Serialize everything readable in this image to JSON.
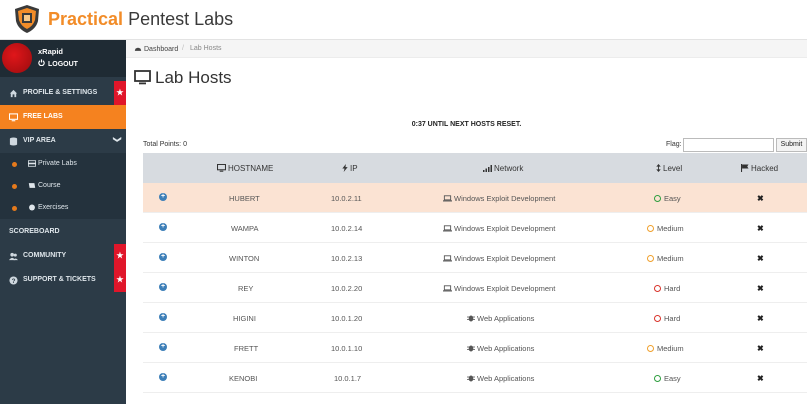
{
  "brand": {
    "part1": "Practical",
    "part2": " Pentest Labs"
  },
  "user": {
    "name": "xRapid",
    "logout_label": "LOGOUT"
  },
  "sidebar": {
    "items": [
      {
        "label": "PROFILE & SETTINGS",
        "icon": "home-icon",
        "star": "★"
      },
      {
        "label": "FREE LABS",
        "icon": "monitor-icon"
      },
      {
        "label": "VIP AREA",
        "icon": "database-icon",
        "chevron": "❯"
      },
      {
        "label": "SCOREBOARD",
        "icon": "none"
      },
      {
        "label": "COMMUNITY",
        "icon": "users-icon",
        "star": "★"
      },
      {
        "label": "SUPPORT & TICKETS",
        "icon": "question-icon",
        "star": "★"
      }
    ],
    "vip_sub": [
      {
        "label": "Private Labs",
        "icon": "server-icon"
      },
      {
        "label": "Course",
        "icon": "book-icon"
      },
      {
        "label": "Exercises",
        "icon": "globe-icon"
      }
    ]
  },
  "breadcrumb": {
    "home": "Dashboard",
    "separator": "/",
    "current": "Lab Hosts"
  },
  "page": {
    "title": "Lab Hosts",
    "timer": "0:37 UNTIL NEXT HOSTS RESET.",
    "total_points": "Total Points: 0",
    "flag_label": "Flag:",
    "flag_value": "",
    "submit_label": "Submit"
  },
  "table": {
    "headers": {
      "hostname": "HOSTNAME",
      "ip": "IP",
      "network": "Network",
      "level": "Level",
      "hacked": "Hacked"
    },
    "rows": [
      {
        "hostname": "HUBERT",
        "ip": "10.0.2.11",
        "network": "Windows Exploit Development",
        "net_icon": "laptop-icon",
        "level": "Easy",
        "level_color": "#2e9e3f",
        "hacked": "✖",
        "highlight": true
      },
      {
        "hostname": "WAMPA",
        "ip": "10.0.2.14",
        "network": "Windows Exploit Development",
        "net_icon": "laptop-icon",
        "level": "Medium",
        "level_color": "#f0a02c",
        "hacked": "✖"
      },
      {
        "hostname": "WINTON",
        "ip": "10.0.2.13",
        "network": "Windows Exploit Development",
        "net_icon": "laptop-icon",
        "level": "Medium",
        "level_color": "#f0a02c",
        "hacked": "✖"
      },
      {
        "hostname": "REY",
        "ip": "10.0.2.20",
        "network": "Windows Exploit Development",
        "net_icon": "laptop-icon",
        "level": "Hard",
        "level_color": "#d9342b",
        "hacked": "✖"
      },
      {
        "hostname": "HIGINI",
        "ip": "10.0.1.20",
        "network": "Web Applications",
        "net_icon": "bug-icon",
        "level": "Hard",
        "level_color": "#d9342b",
        "hacked": "✖"
      },
      {
        "hostname": "FRETT",
        "ip": "10.0.1.10",
        "network": "Web Applications",
        "net_icon": "bug-icon",
        "level": "Medium",
        "level_color": "#f0a02c",
        "hacked": "✖"
      },
      {
        "hostname": "KENOBI",
        "ip": "10.0.1.7",
        "network": "Web Applications",
        "net_icon": "bug-icon",
        "level": "Easy",
        "level_color": "#2e9e3f",
        "hacked": "✖"
      }
    ]
  },
  "colors": {
    "accent": "#f5821f",
    "sidebar": "#2c3b47",
    "star_badge": "#e0162a",
    "row_highlight": "#fbe3d3"
  }
}
